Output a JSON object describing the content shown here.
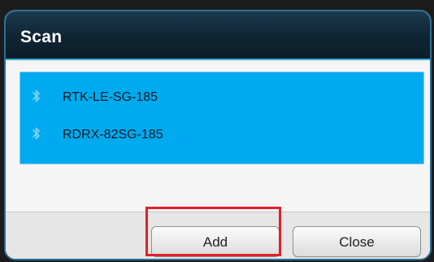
{
  "dialog": {
    "title": "Scan"
  },
  "devices": [
    {
      "name": "RTK-LE-SG-185",
      "icon": "bluetooth-icon"
    },
    {
      "name": "RDRX-82SG-185",
      "icon": "bluetooth-icon"
    }
  ],
  "buttons": {
    "add_label": "Add",
    "close_label": "Close"
  },
  "colors": {
    "list_selection": "#00aaef",
    "title_bar": "#0f2433",
    "highlight_box": "#e2202a"
  }
}
